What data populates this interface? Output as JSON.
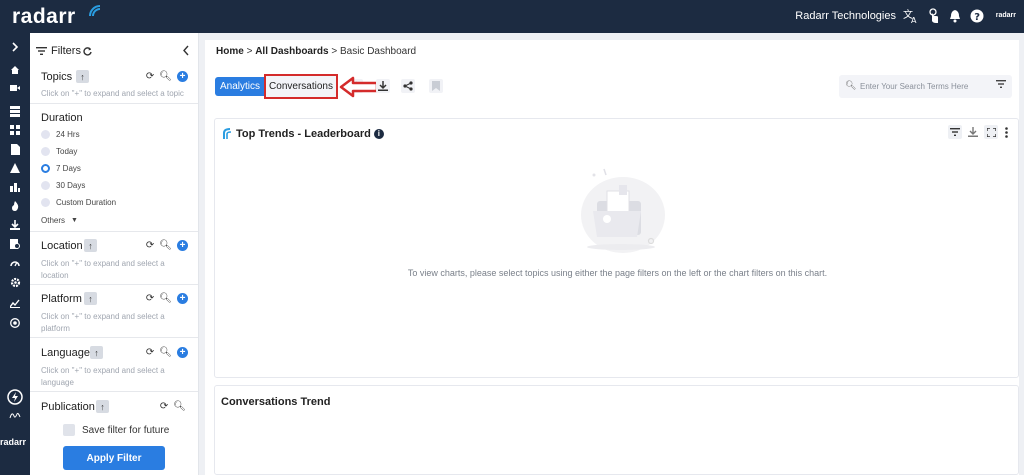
{
  "app": {
    "logo": "radarr",
    "org_name": "Radarr Technologies",
    "brand_small": "radarr"
  },
  "rail": {
    "bottom_brand": "radarr"
  },
  "filters": {
    "title": "Filters",
    "topics": {
      "title": "Topics",
      "hint": "Click on \"+\" to expand and select a topic"
    },
    "duration": {
      "title": "Duration",
      "options": [
        "24 Hrs",
        "Today",
        "7 Days",
        "30 Days",
        "Custom Duration"
      ],
      "selected": "7 Days",
      "others": "Others"
    },
    "location": {
      "title": "Location",
      "hint": "Click on \"+\" to expand and select a location"
    },
    "platform": {
      "title": "Platform",
      "hint": "Click on \"+\" to expand and select a platform"
    },
    "language": {
      "title": "Language",
      "hint": "Click on \"+\" to expand and select a language"
    },
    "publication": {
      "title": "Publication"
    },
    "save_label": "Save filter for future",
    "apply_label": "Apply Filter"
  },
  "breadcrumb": {
    "home": "Home",
    "sep": ">",
    "all": "All Dashboards",
    "current": "Basic Dashboard"
  },
  "tabs": {
    "analytics": "Analytics",
    "conversations": "Conversations"
  },
  "search": {
    "placeholder": "Enter Your Search Terms Here"
  },
  "cards": {
    "leaderboard": {
      "title": "Top Trends - Leaderboard",
      "empty_message": "To view charts, please select topics using either the page filters on the left or the chart filters on this chart."
    },
    "trend": {
      "title": "Conversations Trend"
    }
  },
  "colors": {
    "topbar": "#1c2b41",
    "accent": "#2a7de1",
    "highlight": "#d42b2b"
  }
}
